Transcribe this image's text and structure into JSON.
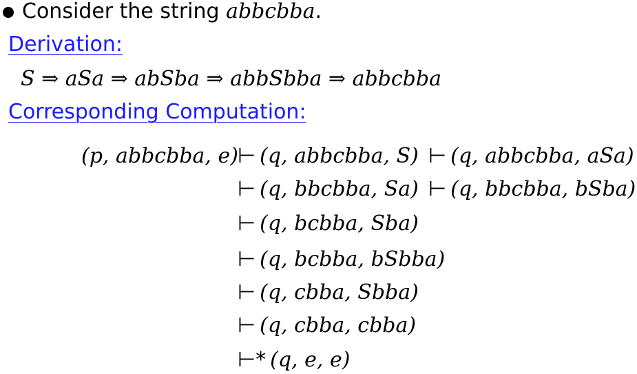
{
  "intro": {
    "text": "Consider the string ",
    "string_value": "abbcbba",
    "period": "."
  },
  "derivation": {
    "heading": "Derivation:",
    "expression": "S ⇒ aSa ⇒ abSba ⇒ abbSbba ⇒ abbcbba"
  },
  "computation": {
    "heading": "Corresponding Computation:",
    "start": "(p, abbcbba, e)",
    "row1": [
      "(q, abbcbba, S)",
      "(q, abbcbba, aSa)"
    ],
    "row2": [
      "(q, bbcbba, Sa)",
      "(q, bbcbba, bSba)"
    ],
    "row3": "(q, bcbba, Sba)",
    "row4": "(q, bcbba, bSbba)",
    "row5": "(q, cbba, Sbba)",
    "row6": "(q, cbba, cbba)",
    "row7": "(q, e, e)",
    "turnstile": "⊢",
    "turnstile_star": "⊢*"
  }
}
